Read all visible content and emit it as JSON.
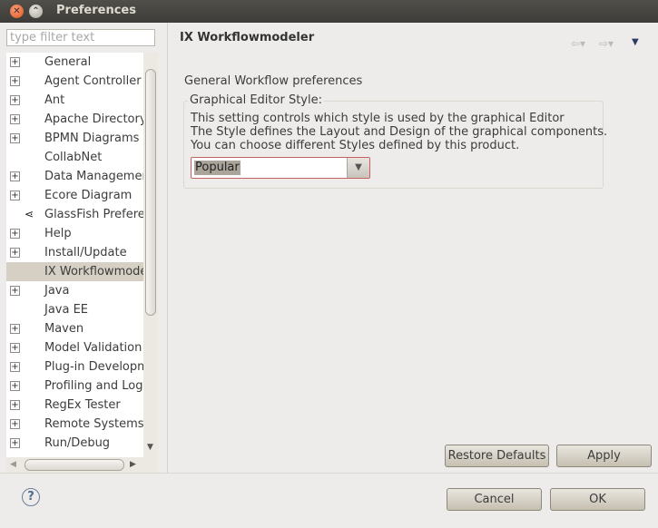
{
  "window": {
    "title": "Preferences"
  },
  "filter": {
    "placeholder": "type filter text"
  },
  "tree": {
    "items": [
      {
        "label": "General",
        "expandable": true
      },
      {
        "label": "Agent Controller",
        "expandable": true
      },
      {
        "label": "Ant",
        "expandable": true
      },
      {
        "label": "Apache Directory",
        "expandable": true
      },
      {
        "label": "BPMN Diagrams",
        "expandable": true
      },
      {
        "label": "CollabNet",
        "expandable": false
      },
      {
        "label": "Data Managemen",
        "expandable": true
      },
      {
        "label": "Ecore Diagram",
        "expandable": true
      },
      {
        "label": "GlassFish Prefere",
        "expandable": false,
        "icon": "glassfish-icon"
      },
      {
        "label": "Help",
        "expandable": true
      },
      {
        "label": "Install/Update",
        "expandable": true
      },
      {
        "label": "IX Workflowmode",
        "expandable": false,
        "selected": true
      },
      {
        "label": "Java",
        "expandable": true
      },
      {
        "label": "Java EE",
        "expandable": false
      },
      {
        "label": "Maven",
        "expandable": true
      },
      {
        "label": "Model Validation",
        "expandable": true
      },
      {
        "label": "Plug-in Developm",
        "expandable": true
      },
      {
        "label": "Profiling and Logg",
        "expandable": true
      },
      {
        "label": "RegEx Tester",
        "expandable": true
      },
      {
        "label": "Remote Systems",
        "expandable": true
      },
      {
        "label": "Run/Debug",
        "expandable": true
      }
    ]
  },
  "page": {
    "title": "IX Workflowmodeler",
    "description": "General Workflow preferences",
    "group_label": "Graphical Editor Style:",
    "group_text_1": "This setting controls which style is used by the graphical Editor",
    "group_text_2": "The Style defines the Layout and Design of the graphical components.",
    "group_text_3": "You can choose different Styles defined by this product.",
    "style_value": "Popular",
    "restore_defaults_label": "Restore Defaults",
    "apply_label": "Apply"
  },
  "footer": {
    "cancel_label": "Cancel",
    "ok_label": "OK"
  },
  "icons": {
    "close": "close-icon",
    "maximize": "maximize-icon",
    "back": "back-arrow-icon",
    "forward": "forward-arrow-icon",
    "menu": "view-menu-icon",
    "help": "help-icon"
  },
  "colors": {
    "titlebar": "#3d3c38",
    "close_button": "#e2531b",
    "selection": "#d6d0c4"
  }
}
